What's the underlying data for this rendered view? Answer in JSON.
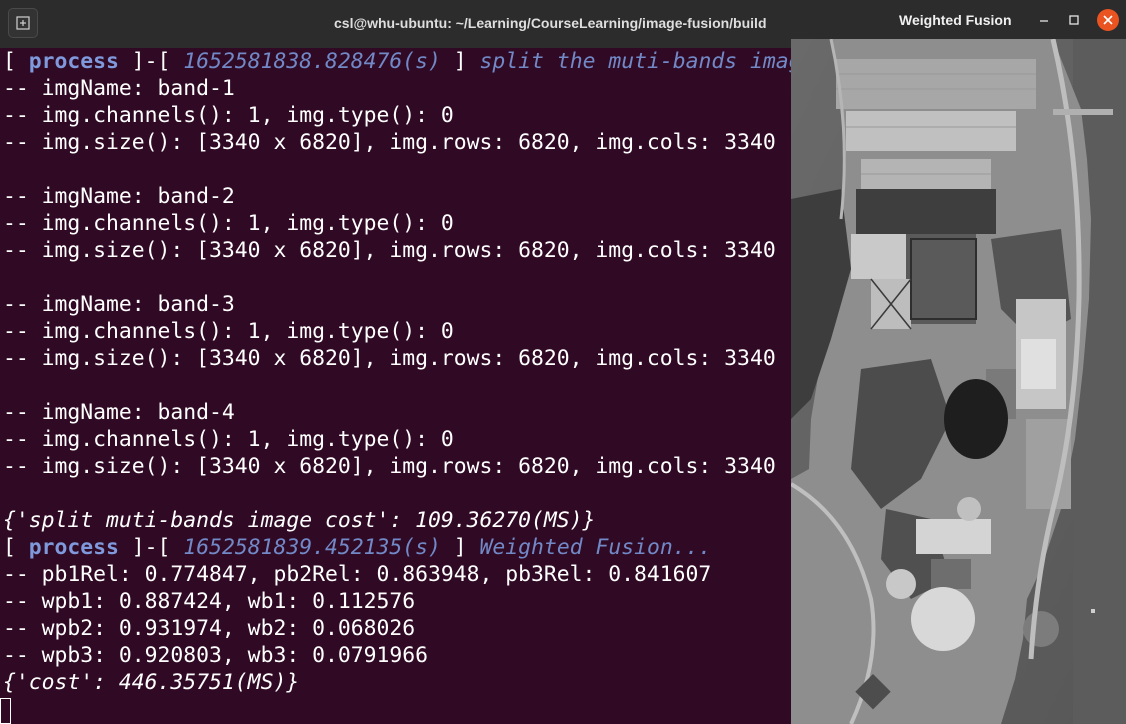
{
  "terminal": {
    "title": "csl@whu-ubuntu: ~/Learning/CourseLearning/image-fusion/build",
    "new_tab_icon": "new-tab-icon",
    "lines": [
      {
        "type": "process",
        "keyword": "process",
        "timestamp": "1652581838.828476(s)",
        "message": "split the muti-bands image..."
      },
      {
        "type": "text",
        "text": "-- imgName: band-1"
      },
      {
        "type": "text",
        "text": "-- img.channels(): 1, img.type(): 0"
      },
      {
        "type": "text",
        "text": "-- img.size(): [3340 x 6820], img.rows: 6820, img.cols: 3340"
      },
      {
        "type": "empty",
        "text": ""
      },
      {
        "type": "text",
        "text": "-- imgName: band-2"
      },
      {
        "type": "text",
        "text": "-- img.channels(): 1, img.type(): 0"
      },
      {
        "type": "text",
        "text": "-- img.size(): [3340 x 6820], img.rows: 6820, img.cols: 3340"
      },
      {
        "type": "empty",
        "text": ""
      },
      {
        "type": "text",
        "text": "-- imgName: band-3"
      },
      {
        "type": "text",
        "text": "-- img.channels(): 1, img.type(): 0"
      },
      {
        "type": "text",
        "text": "-- img.size(): [3340 x 6820], img.rows: 6820, img.cols: 3340"
      },
      {
        "type": "empty",
        "text": ""
      },
      {
        "type": "text",
        "text": "-- imgName: band-4"
      },
      {
        "type": "text",
        "text": "-- img.channels(): 1, img.type(): 0"
      },
      {
        "type": "text",
        "text": "-- img.size(): [3340 x 6820], img.rows: 6820, img.cols: 3340"
      },
      {
        "type": "empty",
        "text": ""
      },
      {
        "type": "cost",
        "text": "{'split muti-bands image cost': 109.36270(MS)}"
      },
      {
        "type": "process",
        "keyword": "process",
        "timestamp": "1652581839.452135(s)",
        "message": "Weighted Fusion..."
      },
      {
        "type": "text",
        "text": "-- pb1Rel: 0.774847, pb2Rel: 0.863948, pb3Rel: 0.841607"
      },
      {
        "type": "text",
        "text": "-- wpb1: 0.887424, wb1: 0.112576"
      },
      {
        "type": "text",
        "text": "-- wpb2: 0.931974, wb2: 0.068026"
      },
      {
        "type": "text",
        "text": "-- wpb3: 0.920803, wb3: 0.0791966"
      },
      {
        "type": "cost",
        "text": "{'cost': 446.35751(MS)}"
      }
    ]
  },
  "image_window": {
    "title": "Weighted Fusion",
    "minimize_icon": "minimize-icon",
    "maximize_icon": "maximize-icon",
    "close_icon": "close-icon",
    "image_icon": "aerial-grayscale-image"
  },
  "colors": {
    "terminal_bg": "#300a24",
    "titlebar_bg": "#2c2c2c",
    "keyword": "#7f99dc",
    "italic_blue": "#7289c8",
    "close_button": "#e95420"
  }
}
